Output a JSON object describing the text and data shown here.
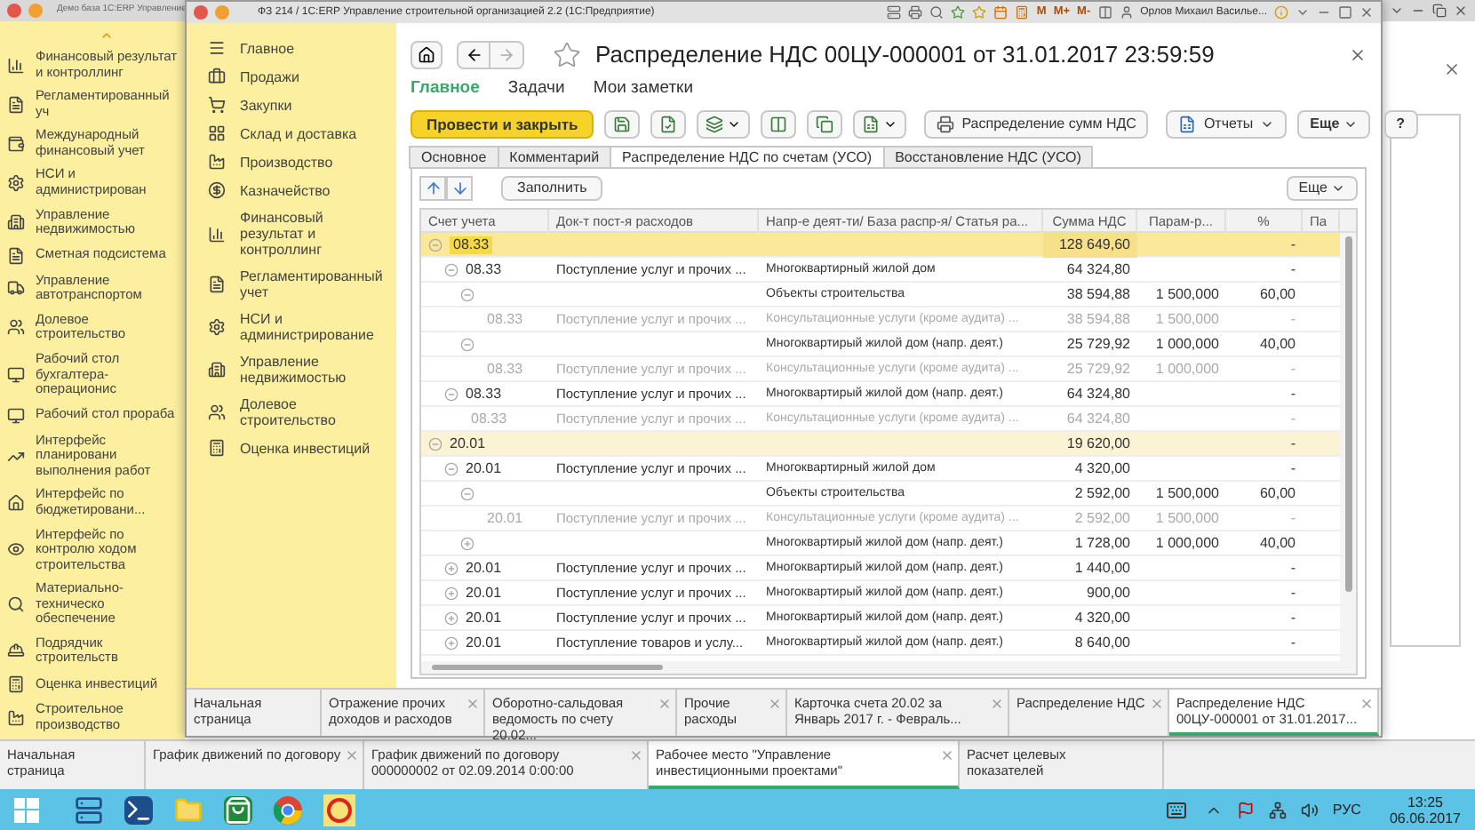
{
  "back_window": {
    "title": "Демо база 1С:ERP Управление",
    "sections": [
      "Финансовый результат и контроллинг",
      "Регламентированный уч",
      "Международный финансовый учет",
      "НСИ и администрирован",
      "Управление недвижимостью",
      "Сметная подсистема",
      "Управление автотранспортом",
      "Долевое строительство",
      "Рабочий стол бухгалтера-операционис",
      "Рабочий стол прораба",
      "Интерфейс планировани выполнения работ",
      "Интерфейс по бюджетировани...",
      "Интерфейс по контролю ходом строительства",
      "Материально-техническо обеспечение",
      "Подрядчик строительств",
      "Оценка инвестиций",
      "Строительное производство"
    ],
    "tabs": [
      {
        "label": "Начальная страница",
        "selected": false,
        "closable": false
      },
      {
        "label": "График движений по договору",
        "selected": false,
        "closable": true
      },
      {
        "label": "График движений по договору 000000002 от 02.09.2014 0:00:00",
        "selected": false,
        "closable": true
      },
      {
        "label": "Рабочее место \"Управление инвестиционными проектами\"",
        "selected": true,
        "closable": true
      },
      {
        "label": "Расчет целевых показателей",
        "selected": false,
        "closable": false
      }
    ]
  },
  "front_window": {
    "title": "ФЗ 214 / 1С:ERP Управление строительной организацией 2.2 (1С:Предприятие)",
    "memory_buttons": [
      "M",
      "M+",
      "M-"
    ],
    "user": "Орлов Михаил Василье...",
    "menu": [
      "Главное",
      "Продажи",
      "Закупки",
      "Склад и доставка",
      "Производство",
      "Казначейство",
      "Финансовый результат и контроллинг",
      "Регламентированный учет",
      "НСИ и администрирование",
      "Управление недвижимостью",
      "Долевое строительство",
      "Оценка инвестиций"
    ],
    "document": {
      "title": "Распределение НДС 00ЦУ-000001 от 31.01.2017 23:59:59",
      "favorite": false,
      "nav": [
        {
          "label": "Главное",
          "selected": true
        },
        {
          "label": "Задачи",
          "selected": false
        },
        {
          "label": "Мои заметки",
          "selected": false
        }
      ],
      "toolbar": [
        {
          "kind": "primary",
          "label": "Провести и закрыть"
        },
        {
          "kind": "icon",
          "dropdown": false
        },
        {
          "kind": "icon",
          "dropdown": false
        },
        {
          "kind": "icon",
          "dropdown": true
        },
        {
          "kind": "icon",
          "dropdown": false
        },
        {
          "kind": "icon",
          "dropdown": false
        },
        {
          "kind": "icon",
          "dropdown": true
        },
        {
          "kind": "button",
          "label": "Распределение сумм НДС",
          "dropdown": false
        },
        {
          "kind": "button",
          "label": "Отчеты",
          "dropdown": true
        }
      ],
      "toolbar_right": [
        {
          "label": "Еще",
          "dropdown": true
        },
        {
          "label": "?",
          "dropdown": false
        }
      ],
      "tabs": [
        {
          "label": "Основное",
          "selected": false
        },
        {
          "label": "Комментарий",
          "selected": false
        },
        {
          "label": "Распределение НДС по счетам (УСО)",
          "selected": true
        },
        {
          "label": "Восстановление НДС (УСО)",
          "selected": false
        }
      ],
      "table_toolbar": {
        "fill": "Заполнить",
        "more": "Еще"
      },
      "columns": [
        "Счет учета",
        "Док-т пост-я расходов",
        "Напр-е деят-ти/ База распр-я/ Статья ра...",
        "Сумма НДС",
        "Парам-р...",
        "%",
        "Па"
      ],
      "rows": [
        {
          "kind": "group",
          "selected": true,
          "expanded": true,
          "account": "08.33",
          "amount": "128 649,60",
          "percent": "-",
          "children": [
            {
              "kind": "line",
              "selected": false,
              "expanded": true,
              "account": "08.33",
              "document": "Поступление услуг и прочих ...",
              "basis": "Многоквартирный жилой дом",
              "amount": "64 324,80",
              "percent": "-",
              "children": [
                {
                  "kind": "line",
                  "selected": false,
                  "expanded": true,
                  "basis": "Объекты строительства",
                  "amount": "38 594,88",
                  "parameter": "1 500,000",
                  "percent": "60,00",
                  "children": [
                    {
                      "kind": "detail",
                      "selected": false,
                      "account": "08.33",
                      "document": "Поступление услуг и прочих ...",
                      "basis": "Консультационные услуги (кроме аудита) ...",
                      "amount": "38 594,88",
                      "parameter": "1 500,000",
                      "percent": "-"
                    }
                  ]
                },
                {
                  "kind": "line",
                  "selected": false,
                  "expanded": true,
                  "basis": "Многоквартирый жилой дом (напр. деят.)",
                  "amount": "25 729,92",
                  "parameter": "1 000,000",
                  "percent": "40,00",
                  "children": [
                    {
                      "kind": "detail",
                      "selected": false,
                      "account": "08.33",
                      "document": "Поступление услуг и прочих ...",
                      "basis": "Консультационные услуги (кроме аудита) ...",
                      "amount": "25 729,92",
                      "parameter": "1 000,000",
                      "percent": "-"
                    }
                  ]
                }
              ]
            },
            {
              "kind": "line",
              "selected": false,
              "expanded": true,
              "account": "08.33",
              "document": "Поступление услуг и прочих ...",
              "basis": "Многоквартирый жилой дом (напр. деят.)",
              "amount": "64 324,80",
              "percent": "-",
              "children": [
                {
                  "kind": "detail",
                  "selected": false,
                  "account": "08.33",
                  "document": "Поступление услуг и прочих ...",
                  "basis": "Консультационные услуги (кроме аудита) ...",
                  "amount": "64 324,80",
                  "percent": "-"
                }
              ]
            }
          ]
        },
        {
          "kind": "group",
          "selected": false,
          "expanded": true,
          "account": "20.01",
          "amount": "19 620,00",
          "percent": "-",
          "children": [
            {
              "kind": "line",
              "selected": false,
              "expanded": true,
              "account": "20.01",
              "document": "Поступление услуг и прочих ...",
              "basis": "Многоквартирный жилой дом",
              "amount": "4 320,00",
              "percent": "-",
              "children": [
                {
                  "kind": "line",
                  "selected": false,
                  "expanded": true,
                  "basis": "Объекты строительства",
                  "amount": "2 592,00",
                  "parameter": "1 500,000",
                  "percent": "60,00",
                  "children": [
                    {
                      "kind": "detail",
                      "selected": false,
                      "account": "20.01",
                      "document": "Поступление услуг и прочих ...",
                      "basis": "Консультационные услуги (кроме аудита) ...",
                      "amount": "2 592,00",
                      "parameter": "1 500,000",
                      "percent": "-"
                    }
                  ]
                },
                {
                  "kind": "line",
                  "selected": false,
                  "expanded": false,
                  "basis": "Многоквартирый жилой дом (напр. деят.)",
                  "amount": "1 728,00",
                  "parameter": "1 000,000",
                  "percent": "40,00"
                }
              ]
            },
            {
              "kind": "line",
              "selected": false,
              "expanded": false,
              "account": "20.01",
              "document": "Поступление услуг и прочих ...",
              "basis": "Многоквартирый жилой дом (напр. деят.)",
              "amount": "1 440,00",
              "percent": "-"
            },
            {
              "kind": "line",
              "selected": false,
              "expanded": false,
              "account": "20.01",
              "document": "Поступление услуг и прочих ...",
              "basis": "Многоквартирый жилой дом (напр. деят.)",
              "amount": "900,00",
              "percent": "-"
            },
            {
              "kind": "line",
              "selected": false,
              "expanded": false,
              "account": "20.01",
              "document": "Поступление услуг и прочих ...",
              "basis": "Многоквартирый жилой дом (напр. деят.)",
              "amount": "4 320,00",
              "percent": "-"
            },
            {
              "kind": "line",
              "selected": false,
              "expanded": false,
              "account": "20.01",
              "document": "Поступление товаров и услу...",
              "basis": "Многоквартирый жилой дом (напр. деят.)",
              "amount": "8 640,00",
              "percent": "-"
            }
          ]
        }
      ]
    },
    "tabs": [
      {
        "label": "Начальная страница",
        "selected": false,
        "closable": false
      },
      {
        "label": "Отражение прочих доходов и расходов",
        "selected": false,
        "closable": true
      },
      {
        "label": "Оборотно-сальдовая ведомость по счету 20.02...",
        "selected": false,
        "closable": true
      },
      {
        "label": "Прочие расходы",
        "selected": false,
        "closable": true
      },
      {
        "label": "Карточка счета 20.02  за Январь 2017 г. - Февраль...",
        "selected": false,
        "closable": true
      },
      {
        "label": "Распределение НДС",
        "selected": false,
        "closable": true
      },
      {
        "label": "Распределение НДС 00ЦУ-000001 от 31.01.2017...",
        "selected": true,
        "closable": true
      }
    ]
  },
  "taskbar": {
    "language": "РУС",
    "time": "13:25",
    "date": "06.06.2017"
  }
}
